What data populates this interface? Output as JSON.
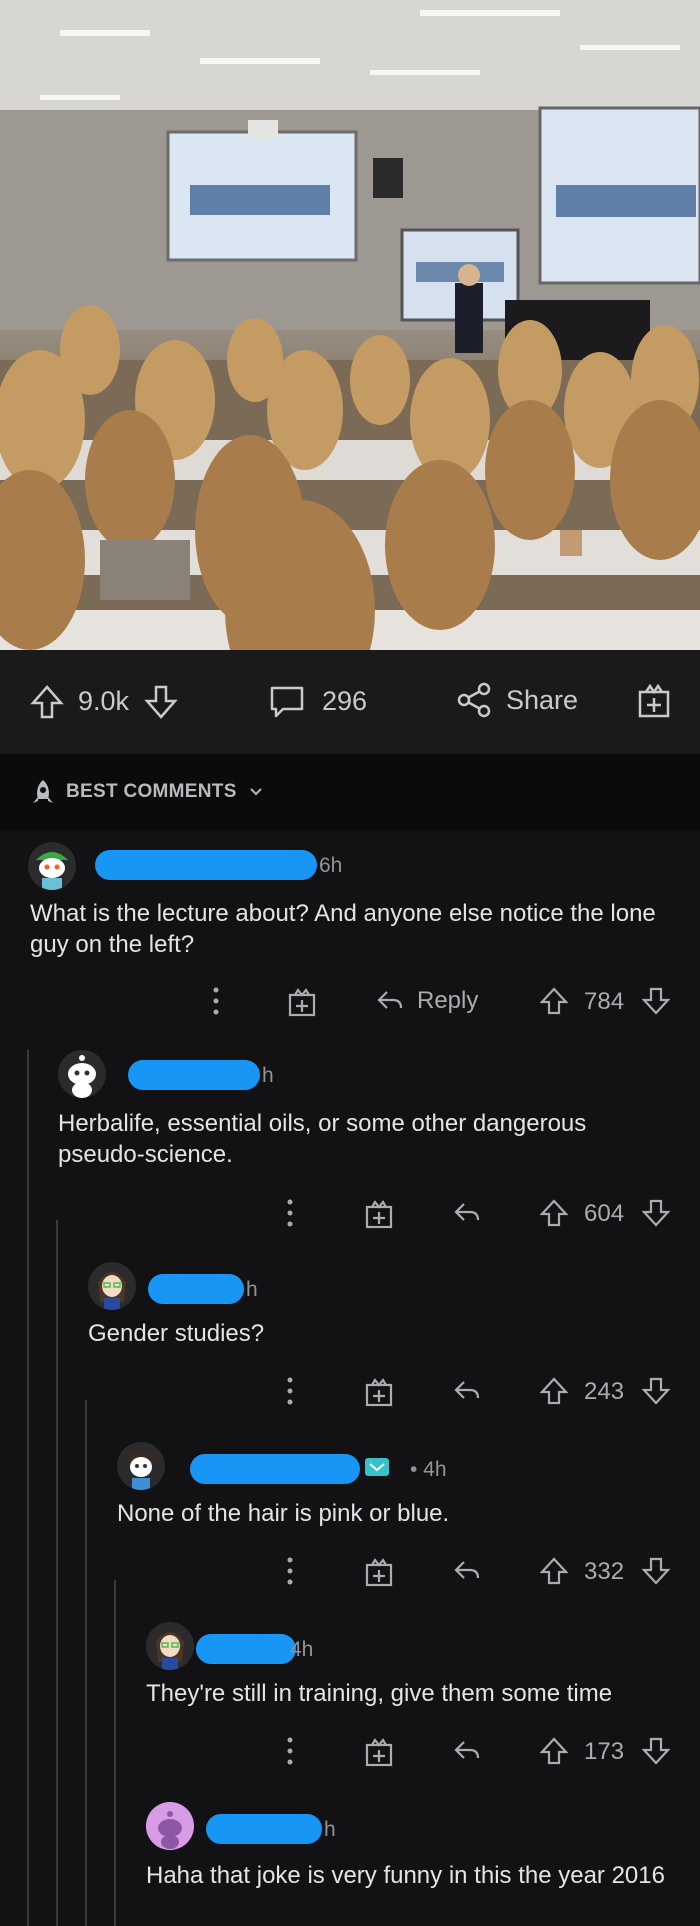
{
  "post": {
    "upvotes": "9.0k",
    "comments_count": "296",
    "share_label": "Share"
  },
  "sort": {
    "label": "BEST COMMENTS"
  },
  "comments": [
    {
      "time": "6h",
      "body": "What is the lecture about? And anyone else notice the lone guy on the left?",
      "reply_label": "Reply",
      "score": "784"
    },
    {
      "time": "h",
      "body": "Herbalife, essential oils, or some other dangerous pseudo-science.",
      "score": "604"
    },
    {
      "time": "h",
      "body": "Gender studies?",
      "score": "243"
    },
    {
      "time": "• 4h",
      "body": "None of the hair is pink or blue.",
      "score": "332"
    },
    {
      "time": "4h",
      "body": "They're still in training, give them some time",
      "score": "173"
    },
    {
      "time": "h",
      "body": "Haha that joke is very funny in this the year 2016"
    }
  ],
  "colors": {
    "background": "#121214",
    "bar": "#1a1a1b",
    "redaction": "#1896f5",
    "text": "#d7dadc"
  },
  "icons": [
    "upvote-icon",
    "downvote-icon",
    "comment-icon",
    "share-icon",
    "award-icon",
    "more-icon",
    "reply-icon",
    "rocket-icon",
    "chevron-down-icon"
  ]
}
